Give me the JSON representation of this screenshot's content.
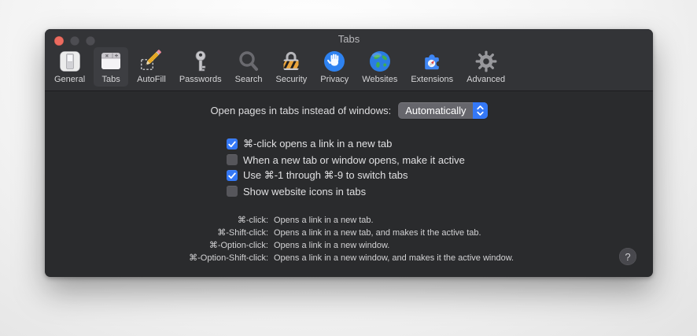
{
  "window": {
    "title": "Tabs",
    "help_label": "?"
  },
  "toolbar": {
    "items": [
      {
        "label": "General",
        "icon": "general-switch-icon",
        "selected": false
      },
      {
        "label": "Tabs",
        "icon": "tabs-window-icon",
        "selected": true
      },
      {
        "label": "AutoFill",
        "icon": "autofill-pencil-icon",
        "selected": false
      },
      {
        "label": "Passwords",
        "icon": "passwords-key-icon",
        "selected": false
      },
      {
        "label": "Search",
        "icon": "search-magnifier-icon",
        "selected": false
      },
      {
        "label": "Security",
        "icon": "security-lock-icon",
        "selected": false
      },
      {
        "label": "Privacy",
        "icon": "privacy-hand-icon",
        "selected": false
      },
      {
        "label": "Websites",
        "icon": "websites-globe-icon",
        "selected": false
      },
      {
        "label": "Extensions",
        "icon": "extensions-puzzle-icon",
        "selected": false
      },
      {
        "label": "Advanced",
        "icon": "advanced-gear-icon",
        "selected": false
      }
    ]
  },
  "content": {
    "open_pages_label": "Open pages in tabs instead of windows:",
    "open_pages_value": "Automatically",
    "checkboxes": [
      {
        "label": "⌘-click opens a link in a new tab",
        "checked": true
      },
      {
        "label": "When a new tab or window opens, make it active",
        "checked": false
      },
      {
        "label": "Use ⌘-1 through ⌘-9 to switch tabs",
        "checked": true
      },
      {
        "label": "Show website icons in tabs",
        "checked": false
      }
    ],
    "shortcut_help": [
      {
        "shortcut": "⌘-click:",
        "description": "Opens a link in a new tab."
      },
      {
        "shortcut": "⌘-Shift-click:",
        "description": "Opens a link in a new tab, and makes it the active tab."
      },
      {
        "shortcut": "⌘-Option-click:",
        "description": "Opens a link in a new window."
      },
      {
        "shortcut": "⌘-Option-Shift-click:",
        "description": "Opens a link in a new window, and makes it the active window."
      }
    ]
  },
  "colors": {
    "accent_blue": "#3478f6",
    "toolbar_bg": "#333437",
    "content_bg": "#2a2b2d",
    "popup_gray": "#66666c",
    "checkbox_unchecked": "#56565b",
    "help_circle": "#48484d",
    "traffic_close_red": "#ec6b5f",
    "traffic_inactive_gray": "#4d4d52"
  }
}
